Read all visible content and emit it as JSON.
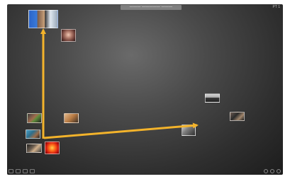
{
  "window": {
    "title_bar_text": "——— ————— ———",
    "corner_label": "PT 1"
  },
  "photos": [
    {
      "name": "photo-group-top-left",
      "caption": ""
    },
    {
      "name": "photo-portrait-top",
      "caption": ""
    },
    {
      "name": "photo-left-1",
      "caption": ""
    },
    {
      "name": "photo-left-2",
      "caption": ""
    },
    {
      "name": "photo-left-3",
      "caption": ""
    },
    {
      "name": "photo-left-4",
      "caption": ""
    },
    {
      "name": "photo-flower-red",
      "caption": ""
    },
    {
      "name": "photo-mid-small",
      "caption": ""
    },
    {
      "name": "photo-right-landscape",
      "caption": ""
    },
    {
      "name": "photo-right-far",
      "caption": ""
    },
    {
      "name": "photo-selected-arrow-target",
      "caption": ""
    }
  ],
  "arrows": {
    "color": "#f3b32b"
  },
  "toolbar": {
    "left_icons": [
      "grid-icon",
      "list-icon",
      "split-icon",
      "square-icon"
    ],
    "right_icons": [
      "share-icon",
      "info-icon",
      "close-icon"
    ]
  }
}
